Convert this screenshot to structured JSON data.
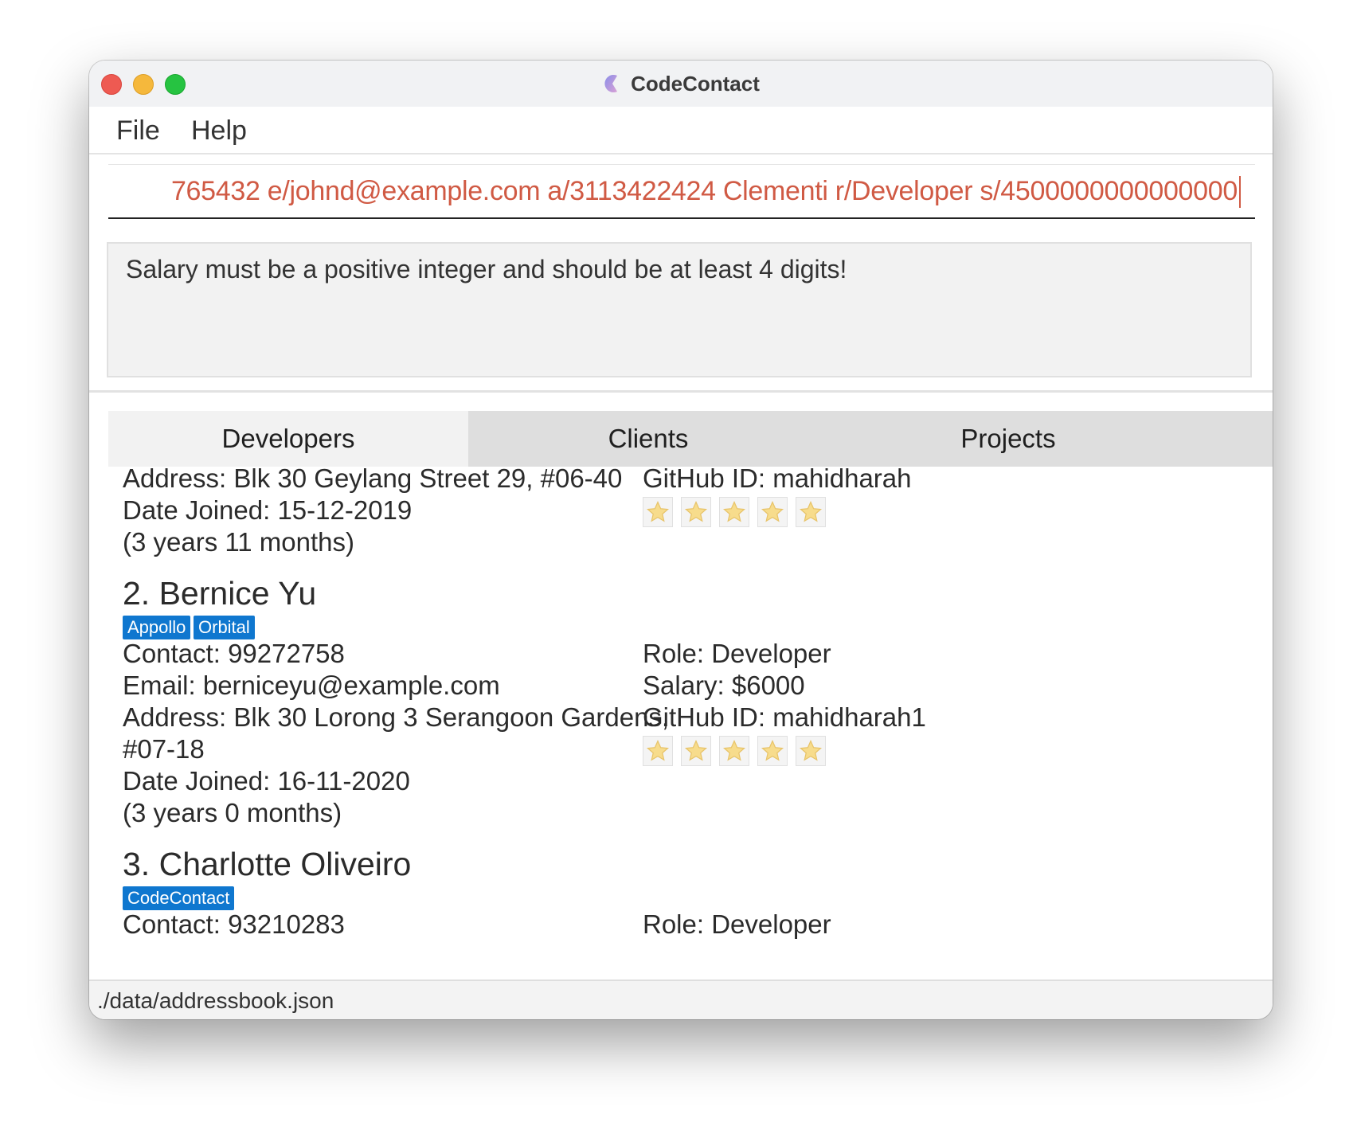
{
  "window": {
    "title": "CodeContact"
  },
  "menu": {
    "file": "File",
    "help": "Help"
  },
  "command": {
    "value": "765432 e/johnd@example.com a/3113422424 Clementi r/Developer  s/4500000000000000"
  },
  "result": {
    "message": "Salary must be a positive integer and should be at least 4 digits!"
  },
  "tabs": [
    {
      "label": "Developers",
      "active": true
    },
    {
      "label": "Clients",
      "active": false
    },
    {
      "label": "Projects",
      "active": false
    }
  ],
  "developers": {
    "first": {
      "address": "Address: Blk 30 Geylang Street 29, #06-40",
      "date_joined": "Date Joined: 15-12-2019",
      "tenure": "(3 years 11 months)",
      "github": "GitHub ID: mahidharah",
      "rating": 5
    },
    "second": {
      "name": "2.  Bernice Yu",
      "tags": [
        "Appollo",
        "Orbital"
      ],
      "contact": "Contact: 99272758",
      "email": "Email: berniceyu@example.com",
      "address_1": "Address: Blk 30 Lorong 3 Serangoon Gardens,",
      "address_2": "#07-18",
      "date_joined": "Date Joined: 16-11-2020",
      "tenure": "(3 years 0 months)",
      "role": "Role: Developer",
      "salary": "Salary: $6000",
      "github": "GitHub ID: mahidharah1",
      "rating": 5
    },
    "third": {
      "name": "3.  Charlotte Oliveiro",
      "tags": [
        "CodeContact"
      ],
      "contact": "Contact: 93210283",
      "role": "Role: Developer"
    }
  },
  "status": {
    "path": "./data/addressbook.json"
  },
  "colors": {
    "command_text": "#d05a44",
    "tag_bg": "#0f77cf",
    "star_fill": "#f7dc8c"
  }
}
